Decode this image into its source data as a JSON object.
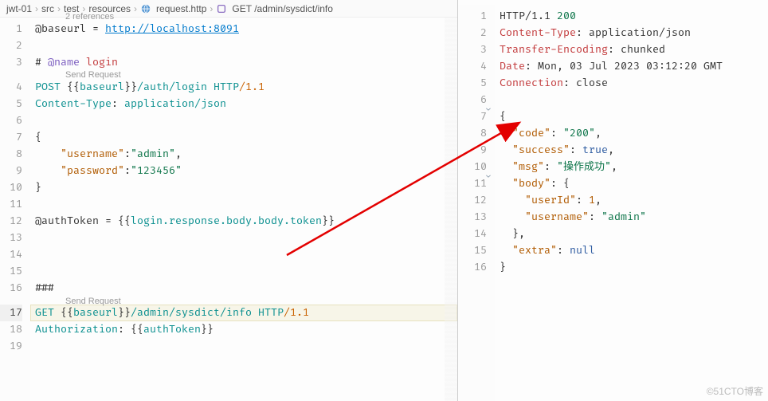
{
  "breadcrumb": {
    "items": [
      "jwt-01",
      "src",
      "test",
      "resources",
      "request.http",
      "GET /admin/sysdict/info"
    ]
  },
  "leftEditor": {
    "references": "2 references",
    "sendRequest1": "Send Request",
    "sendRequest2": "Send Request",
    "lines": {
      "l1": {
        "lhs": "@baseurl",
        "op": " = ",
        "rhs": "http://localhost:8091"
      },
      "l3": {
        "cmt": "# ",
        "at": "@name",
        "name": " login"
      },
      "l4": {
        "method": "POST ",
        "brk1": "{{",
        "var": "baseurl",
        "brk2": "}}",
        "path": "/auth/login ",
        "proto": "HTTP",
        "slash": "/",
        "ver": "1.1"
      },
      "l5": {
        "hdr": "Content-Type",
        "sep": ": ",
        "val": "application/json"
      },
      "l7": "{",
      "l8": {
        "k": "\"username\"",
        "c": ":",
        "v": "\"admin\"",
        "t": ","
      },
      "l9": {
        "k": "\"password\"",
        "c": ":",
        "v": "\"123456\""
      },
      "l10": "}",
      "l12": {
        "pre": "@authToken = ",
        "brk1": "{{",
        "expr": "login.response.body.body.token",
        "brk2": "}}"
      },
      "l16": "###",
      "l17": {
        "method": "GET ",
        "brk1": "{{",
        "var": "baseurl",
        "brk2": "}}",
        "path": "/admin/sysdict/info ",
        "proto": "HTTP",
        "slash": "/",
        "ver": "1.1"
      },
      "l18": {
        "hdr": "Authorization",
        "sep": ": ",
        "brk1": "{{",
        "var": "authToken",
        "brk2": "}}"
      }
    },
    "activeLine": 17,
    "lineCount": 19
  },
  "rightEditor": {
    "lineCount": 16,
    "fold": {
      "l7": "⌄",
      "l11": "⌄"
    },
    "lines": {
      "l1": {
        "proto": "HTTP/1.1 ",
        "code": "200"
      },
      "l2": {
        "hdr": "Content-Type",
        "sep": ": ",
        "val": "application/json"
      },
      "l3": {
        "hdr": "Transfer-Encoding",
        "sep": ": ",
        "val": "chunked"
      },
      "l4": {
        "hdr": "Date",
        "sep": ": ",
        "val": "Mon, 03 Jul 2023 03:12:20 GMT"
      },
      "l5": {
        "hdr": "Connection",
        "sep": ": ",
        "val": "close"
      },
      "l7": "{",
      "l8": {
        "k": "\"code\"",
        "c": ": ",
        "v": "\"200\"",
        "t": ","
      },
      "l9": {
        "k": "\"success\"",
        "c": ": ",
        "v": "true",
        "t": ","
      },
      "l10": {
        "k": "\"msg\"",
        "c": ": ",
        "v": "\"操作成功\"",
        "t": ","
      },
      "l11": {
        "k": "\"body\"",
        "c": ": ",
        "v": "{"
      },
      "l12": {
        "k": "\"userId\"",
        "c": ": ",
        "v": "1",
        "t": ","
      },
      "l13": {
        "k": "\"username\"",
        "c": ": ",
        "v": "\"admin\""
      },
      "l14": "},",
      "l15": {
        "k": "\"extra\"",
        "c": ": ",
        "v": "null"
      },
      "l16": "}"
    }
  },
  "watermark": "©51CTO博客"
}
